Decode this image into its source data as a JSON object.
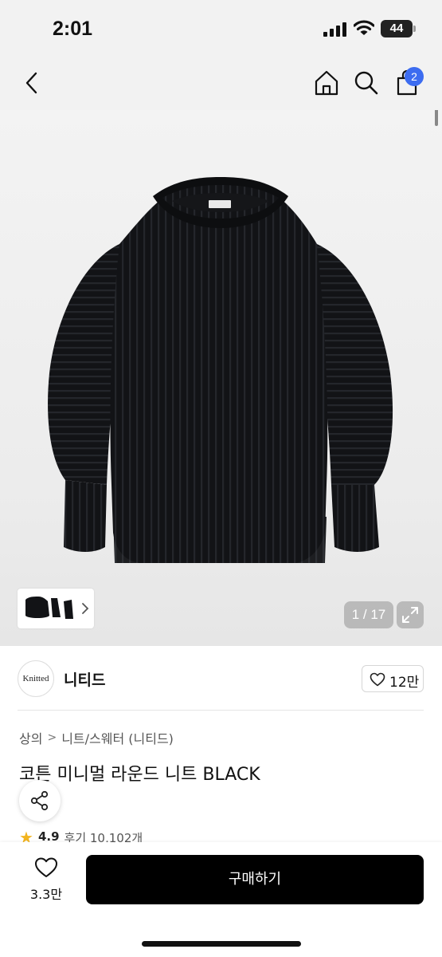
{
  "status_bar": {
    "time": "2:01",
    "battery": "44"
  },
  "nav": {
    "cart_count": "2"
  },
  "gallery": {
    "counter": "1 / 17"
  },
  "brand": {
    "logo_text": "Knitted",
    "name": "니티드",
    "like_count": "12만"
  },
  "product": {
    "breadcrumb": [
      "상의",
      "니트/스웨터 (니티드)"
    ],
    "title": "코튼 미니멀 라운드 니트 BLACK",
    "rating": "4.9",
    "reviews": "후기 10,102개"
  },
  "bottom": {
    "wish_count": "3.3만",
    "buy_label": "구매하기"
  },
  "colors": {
    "accent": "#3c6cf0",
    "star": "#f2b41f",
    "buy_button": "#000000",
    "sweater": "#121316"
  },
  "icons": [
    "back-chevron-icon",
    "home-icon",
    "search-icon",
    "shopping-bag-icon",
    "expand-icon",
    "chevron-right-icon",
    "heart-icon",
    "share-icon",
    "star-icon"
  ]
}
